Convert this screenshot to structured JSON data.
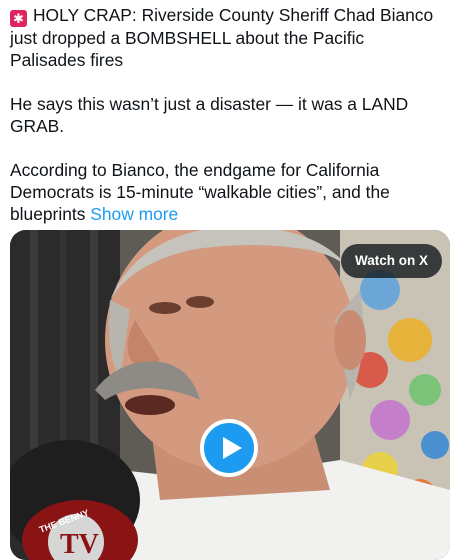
{
  "post": {
    "siren_icon": "police-siren-emoji",
    "headline": "HOLY CRAP: Riverside County Sheriff Chad Bianco just dropped a BOMBSHELL about the Pacific Palisades fires",
    "para2": "He says this wasn’t just a disaster — it was a LAND GRAB.",
    "para3": "According to Bianco, the endgame for California Democrats is 15-minute “walkable cities”, and the blueprints",
    "show_more": "Show more"
  },
  "media": {
    "watch_label": "Watch on X",
    "play_icon": "play-icon",
    "mug_text": "TV",
    "mug_ring_text": "THE BENNY"
  },
  "colors": {
    "link": "#1d9bf0",
    "text": "#0f1419",
    "play": "#1d9bf0"
  }
}
